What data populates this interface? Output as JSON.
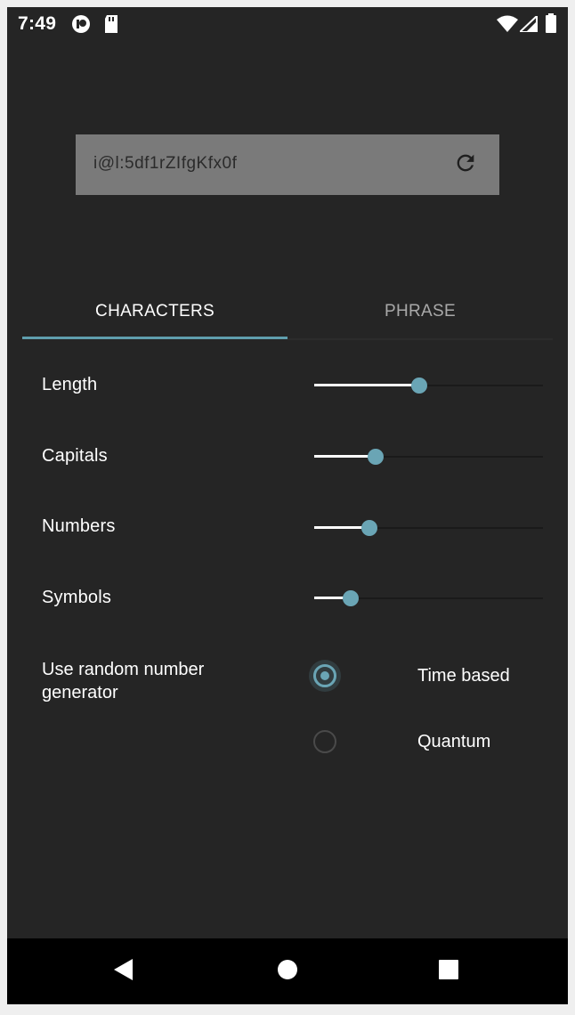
{
  "status_bar": {
    "time": "7:49",
    "left_icons": [
      "notification-app-icon",
      "sd-card-icon"
    ],
    "right_icons": [
      "wifi-icon",
      "cellular-signal-icon",
      "battery-icon"
    ]
  },
  "generated_password": {
    "value": "i@l:5df1rZIfgKfx0f",
    "refresh_icon": "refresh-icon"
  },
  "tabs": [
    {
      "label": "CHARACTERS",
      "selected": true
    },
    {
      "label": "PHRASE",
      "selected": false
    }
  ],
  "settings": {
    "length": {
      "label": "Length",
      "fraction": 0.46
    },
    "capitals": {
      "label": "Capitals",
      "fraction": 0.27
    },
    "numbers": {
      "label": "Numbers",
      "fraction": 0.24
    },
    "symbols": {
      "label": "Symbols",
      "fraction": 0.16
    }
  },
  "rng": {
    "label": "Use random number generator",
    "options": [
      {
        "label": "Time based",
        "selected": true
      },
      {
        "label": "Quantum",
        "selected": false
      }
    ]
  },
  "navigation": {
    "back_icon": "back-triangle-icon",
    "home_icon": "home-circle-icon",
    "recents_icon": "recents-square-icon"
  },
  "colors": {
    "background": "#252525",
    "accent": "#6aa5b5",
    "password_box": "#7a7a7a"
  }
}
